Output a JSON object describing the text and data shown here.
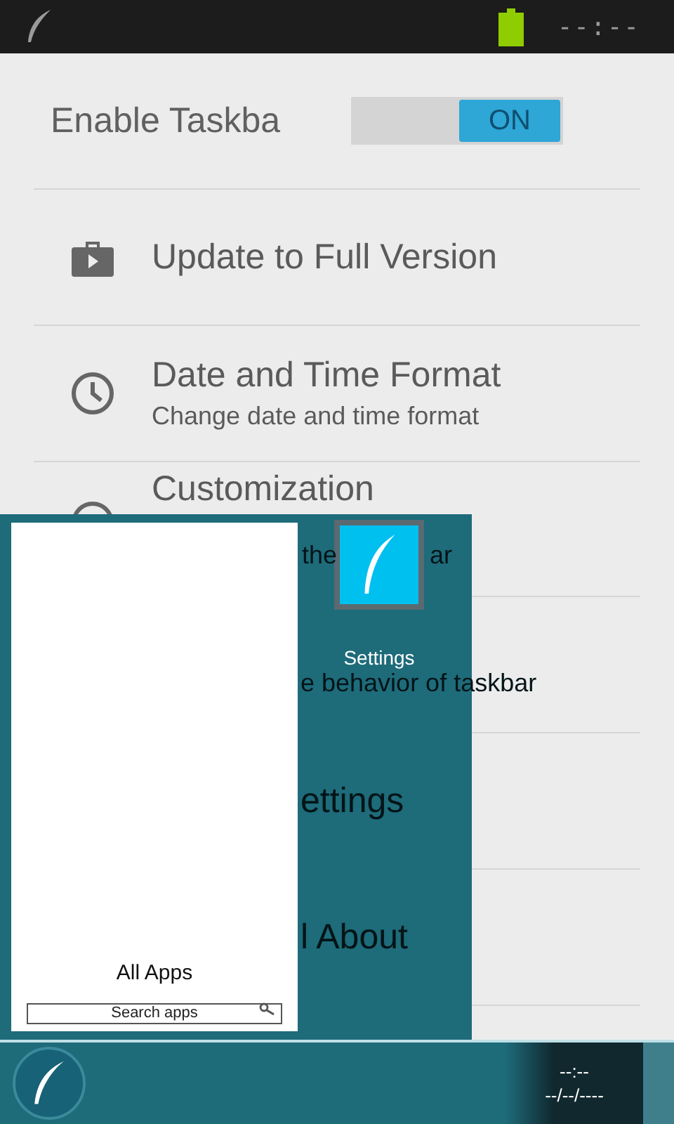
{
  "status_bar": {
    "time": "--:--"
  },
  "toggle_row": {
    "label": "Enable Taskba",
    "toggle": {
      "label": "ON",
      "on": true
    }
  },
  "settings": [
    {
      "kind": "full",
      "title": "Update to Full Version"
    },
    {
      "kind": "full",
      "title": "Date and Time Format",
      "subtitle": "Change date and time format"
    },
    {
      "kind": "split",
      "title": "Customization",
      "subtitle_parts": [
        "the",
        "ar"
      ]
    },
    {
      "kind": "covered",
      "subtitle": "e behavior of taskbar"
    },
    {
      "kind": "covered",
      "title": "ettings"
    },
    {
      "kind": "covered",
      "title": "l About"
    }
  ],
  "start_menu": {
    "all_apps": "All Apps",
    "search": {
      "placeholder": "Search apps"
    },
    "apps": [
      {
        "label": "Settings"
      }
    ]
  },
  "taskbar": {
    "time": "--:--",
    "date": "--/--/----"
  }
}
